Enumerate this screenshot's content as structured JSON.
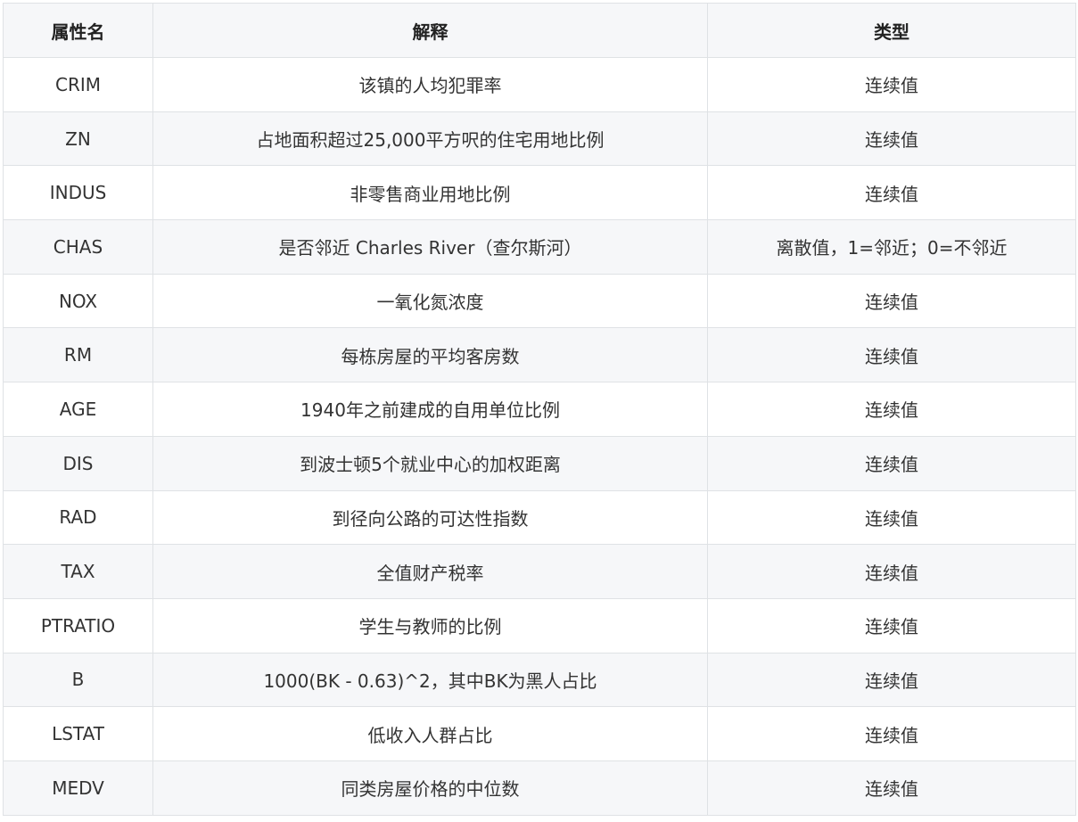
{
  "table": {
    "headers": [
      "属性名",
      "解释",
      "类型"
    ],
    "rows": [
      {
        "name": "CRIM",
        "desc": "该镇的人均犯罪率",
        "type": "连续值"
      },
      {
        "name": "ZN",
        "desc": "占地面积超过25,000平方呎的住宅用地比例",
        "type": "连续值"
      },
      {
        "name": "INDUS",
        "desc": "非零售商业用地比例",
        "type": "连续值"
      },
      {
        "name": "CHAS",
        "desc": "是否邻近 Charles River（查尔斯河）",
        "type": "离散值，1=邻近；0=不邻近"
      },
      {
        "name": "NOX",
        "desc": "一氧化氮浓度",
        "type": "连续值"
      },
      {
        "name": "RM",
        "desc": "每栋房屋的平均客房数",
        "type": "连续值"
      },
      {
        "name": "AGE",
        "desc": "1940年之前建成的自用单位比例",
        "type": "连续值"
      },
      {
        "name": "DIS",
        "desc": "到波士顿5个就业中心的加权距离",
        "type": "连续值"
      },
      {
        "name": "RAD",
        "desc": "到径向公路的可达性指数",
        "type": "连续值"
      },
      {
        "name": "TAX",
        "desc": "全值财产税率",
        "type": "连续值"
      },
      {
        "name": "PTRATIO",
        "desc": "学生与教师的比例",
        "type": "连续值"
      },
      {
        "name": "B",
        "desc": "1000(BK - 0.63)^2，其中BK为黑人占比",
        "type": "连续值"
      },
      {
        "name": "LSTAT",
        "desc": "低收入人群占比",
        "type": "连续值"
      },
      {
        "name": "MEDV",
        "desc": "同类房屋价格的中位数",
        "type": "连续值"
      }
    ]
  }
}
